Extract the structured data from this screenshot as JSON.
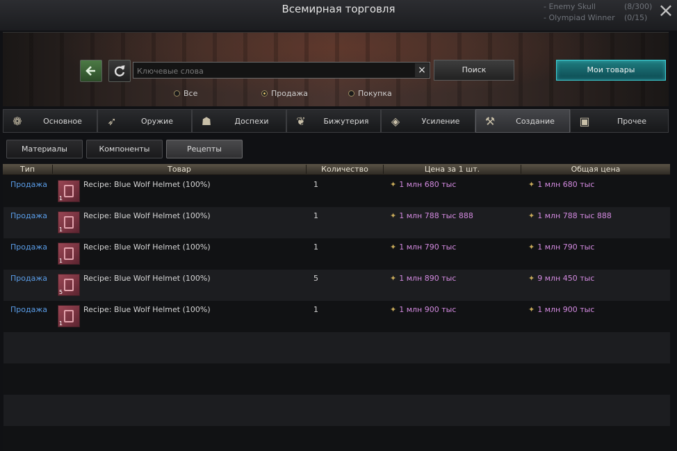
{
  "window": {
    "title": "Всемирная торговля",
    "side_quests": [
      {
        "name": "Enemy Skull",
        "count": "(8/300)"
      },
      {
        "name": "Olympiad Winner",
        "count": "(0/15)"
      }
    ],
    "close_icon": "×"
  },
  "search": {
    "back_icon": "arrow-left-icon",
    "refresh_icon": "refresh-icon",
    "placeholder": "Ключевые слова",
    "value": "",
    "clear_icon": "×",
    "search_label": "Поиск",
    "my_goods_label": "Мои товары"
  },
  "filters": {
    "all_label": "Все",
    "sale_label": "Продажа",
    "buy_label": "Покупка",
    "selected": "Продажа"
  },
  "categories": [
    {
      "label": "Основное",
      "icon": "basic-icon"
    },
    {
      "label": "Оружие",
      "icon": "weapon-icon"
    },
    {
      "label": "Доспехи",
      "icon": "armor-icon"
    },
    {
      "label": "Бижутерия",
      "icon": "jewelry-icon"
    },
    {
      "label": "Усиление",
      "icon": "enhance-icon"
    },
    {
      "label": "Создание",
      "icon": "craft-icon"
    },
    {
      "label": "Прочее",
      "icon": "misc-icon"
    }
  ],
  "active_category": "Создание",
  "subtabs": [
    "Материалы",
    "Компоненты",
    "Рецепты"
  ],
  "active_subtab": "Рецепты",
  "table": {
    "headers": [
      "Тип",
      "Товар",
      "Количество",
      "Цена за 1 шт.",
      "Общая цена"
    ],
    "rows": [
      {
        "type": "Продажа",
        "item": "Recipe: Blue Wolf Helmet (100%)",
        "icon_qty": "1",
        "qty": "1",
        "unit_price": "1 млн 680 тыс",
        "total": "1 млн 680 тыс"
      },
      {
        "type": "Продажа",
        "item": "Recipe: Blue Wolf Helmet (100%)",
        "icon_qty": "1",
        "qty": "1",
        "unit_price": "1 млн 788 тыс 888",
        "total": "1 млн 788 тыс 888"
      },
      {
        "type": "Продажа",
        "item": "Recipe: Blue Wolf Helmet (100%)",
        "icon_qty": "1",
        "qty": "1",
        "unit_price": "1 млн 790 тыс",
        "total": "1 млн 790 тыс"
      },
      {
        "type": "Продажа",
        "item": "Recipe: Blue Wolf Helmet (100%)",
        "icon_qty": "5",
        "qty": "5",
        "unit_price": "1 млн 890 тыс",
        "total": "9 млн 450 тыс"
      },
      {
        "type": "Продажа",
        "item": "Recipe: Blue Wolf Helmet (100%)",
        "icon_qty": "1",
        "qty": "1",
        "unit_price": "1 млн 900 тыс",
        "total": "1 млн 900 тыс"
      }
    ]
  },
  "colors": {
    "price": "#d38ae0",
    "type_link": "#5a9de8",
    "accent_button": "#1f7d80"
  }
}
